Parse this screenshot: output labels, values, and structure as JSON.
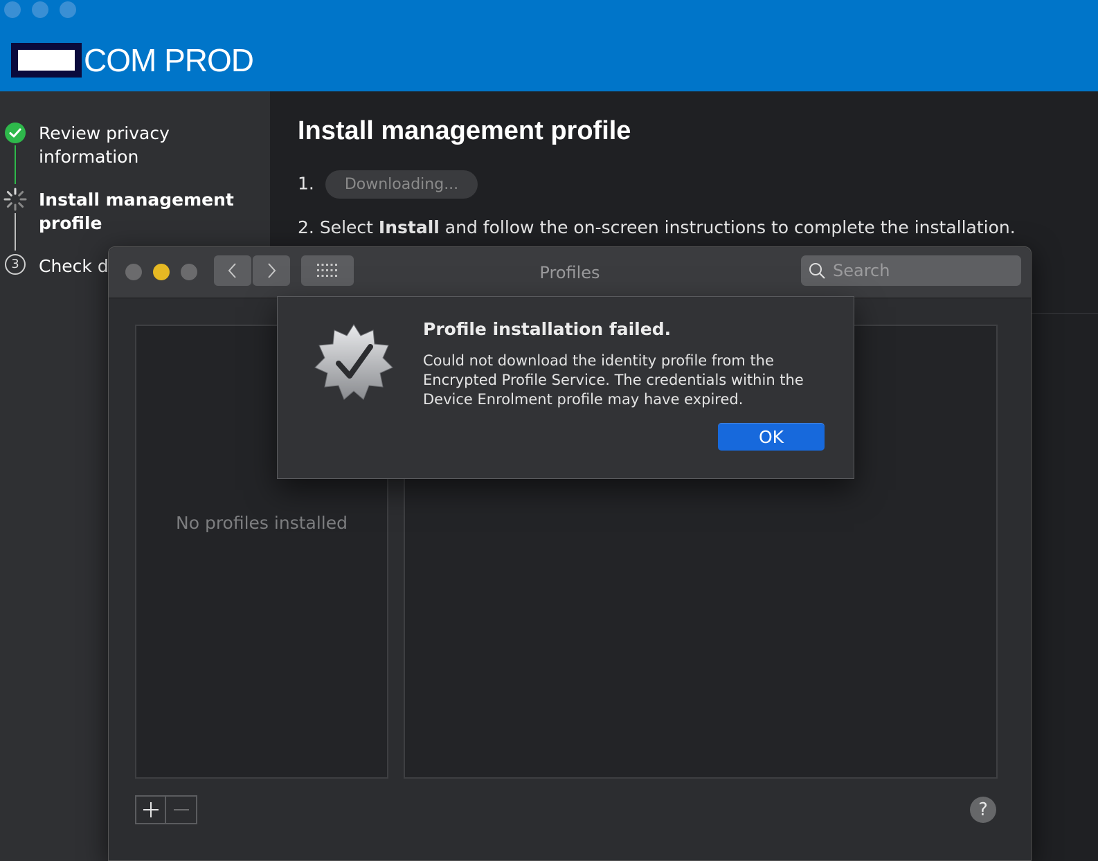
{
  "app": {
    "brand_name": "COM PROD"
  },
  "sidebar": {
    "steps": [
      {
        "label": "Review privacy information",
        "line1": "Review privacy",
        "line2": "information",
        "state": "done"
      },
      {
        "label": "Install management profile",
        "line1": "Install management",
        "line2": "profile",
        "state": "current"
      },
      {
        "label": "Check d",
        "number": "3",
        "state": "pending"
      }
    ]
  },
  "main": {
    "title": "Install management profile",
    "step1_number": "1.",
    "download_button": "Downloading...",
    "step2_number": "2.",
    "step2_prefix": "Select",
    "step2_bold": "Install",
    "step2_suffix": "and follow the on-screen instructions to complete the installation."
  },
  "profiles_window": {
    "title": "Profiles",
    "search_placeholder": "Search",
    "empty_text": "No profiles installed",
    "help_label": "?",
    "traffic_colors": {
      "close": "#6b6b6d",
      "minimize": "#e6b923",
      "zoom": "#6b6b6d"
    }
  },
  "alert": {
    "title": "Profile installation failed.",
    "message": "Could not download the identity profile from the Encrypted Profile Service. The credentials within the Device Enrolment profile may have expired.",
    "ok_label": "OK"
  },
  "colors": {
    "brand_blue": "#0075c9",
    "success_green": "#2eb84b",
    "ok_button": "#1769dc"
  }
}
